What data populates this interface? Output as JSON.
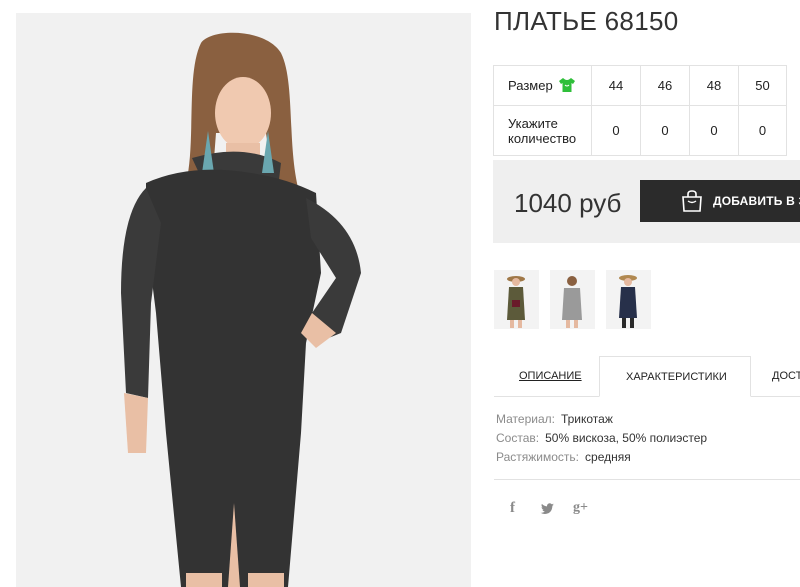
{
  "product": {
    "title": "ПЛАТЬЕ 68150",
    "price": "1040 руб",
    "add_to_cart_label": "ДОБАВИТЬ В ЗАКАЗ"
  },
  "size_table": {
    "size_label": "Размер",
    "quantity_label": "Укажите количество",
    "sizes": [
      "44",
      "46",
      "48",
      "50"
    ],
    "quantities": [
      "0",
      "0",
      "0",
      "0"
    ]
  },
  "tabs": [
    {
      "label": "ОПИСАНИЕ"
    },
    {
      "label": "ХАРАКТЕРИСТИКИ"
    },
    {
      "label": "ДОСТАВКА"
    }
  ],
  "specs": [
    {
      "key": "Материал:",
      "value": "Трикотаж"
    },
    {
      "key": "Состав:",
      "value": "50% вискоза, 50% полиэстер"
    },
    {
      "key": "Растяжимость:",
      "value": "средняя"
    }
  ],
  "social": {
    "facebook": "f",
    "googleplus": "g+"
  },
  "colors": {
    "accent_green": "#2fbf3a",
    "button_dark": "#2b2b2b",
    "price_bg": "#efefef",
    "border": "#e2e2e2"
  },
  "icons": [
    "shirt-icon",
    "shopping-bag-icon",
    "facebook-icon",
    "twitter-icon",
    "googleplus-icon"
  ]
}
